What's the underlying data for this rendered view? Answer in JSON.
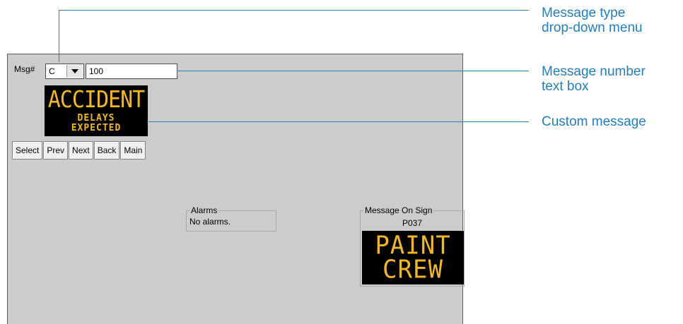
{
  "form": {
    "msg_label": "Msg#",
    "message_type_value": "C",
    "message_number_value": "100"
  },
  "custom_message": {
    "line1": "ACCIDENT",
    "line2": "DELAYS",
    "line3": "EXPECTED"
  },
  "buttons": [
    "Select",
    "Prev",
    "Next",
    "Back",
    "Main"
  ],
  "alarms": {
    "legend": "Alarms",
    "text": "No alarms."
  },
  "message_on_sign": {
    "legend": "Message On Sign",
    "code": "P037",
    "line1": "PAINT",
    "line2": "CREW"
  },
  "callouts": {
    "type_line1": "Message type",
    "type_line2": "drop-down menu",
    "number_line1": "Message number",
    "number_line2": "text box",
    "custom": "Custom message"
  },
  "colors": {
    "callout": "#1f7fc1",
    "sign_text": "#f2b81c",
    "panel_bg": "#cccccc"
  }
}
